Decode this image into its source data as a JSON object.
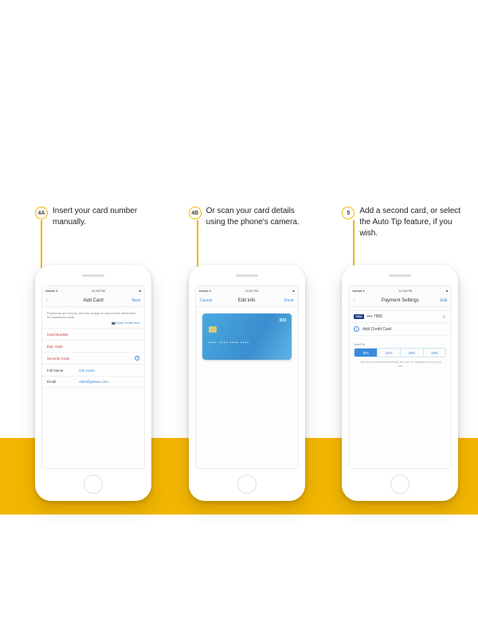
{
  "steps": [
    {
      "num": "4A",
      "text": "Insert your card number manually."
    },
    {
      "num": "4B",
      "text": "Or scan your card details using the phone's camera."
    },
    {
      "num": "5",
      "text": "Add a second card, or select the Auto Tip feature, if you wish."
    }
  ],
  "status": {
    "carrier": "●●●●● ▾",
    "time": "12:35 PM",
    "batt": "■"
  },
  "phone1": {
    "nav": {
      "back": "‹",
      "title": "Add Card",
      "right": "Next"
    },
    "note": "Payments are secure, and the charge is only for the meter fare. No additional costs.",
    "scan": "📷 Scan credit card",
    "fields": [
      {
        "label": "Card Number",
        "value": "",
        "red": true,
        "info": false
      },
      {
        "label": "Exp. Date",
        "value": "",
        "red": true,
        "info": false
      },
      {
        "label": "Security Code",
        "value": "",
        "red": true,
        "info": true
      },
      {
        "label": "Full Name",
        "value": "Odi Joren",
        "red": false,
        "info": false
      },
      {
        "label": "Email",
        "value": "otkol@gettaxi.com",
        "red": false,
        "info": false
      }
    ]
  },
  "phone2": {
    "nav": {
      "left": "Cancel",
      "title": "Edit info",
      "right": "Done"
    },
    "card_num": "•••• •••• •••• ••••"
  },
  "phone3": {
    "nav": {
      "back": "‹",
      "title": "Payment Settings",
      "right": "Edit"
    },
    "card_line": {
      "brand": "VISA",
      "masked": "•••• 7895"
    },
    "add_label": "Add Credit Card",
    "autotip_label": "AutoTip",
    "tips": [
      "5%",
      "10%",
      "15%",
      "18%"
    ],
    "tip_selected": 0,
    "tip_note": "A tip will be added automatically and can be changed during every ride."
  }
}
